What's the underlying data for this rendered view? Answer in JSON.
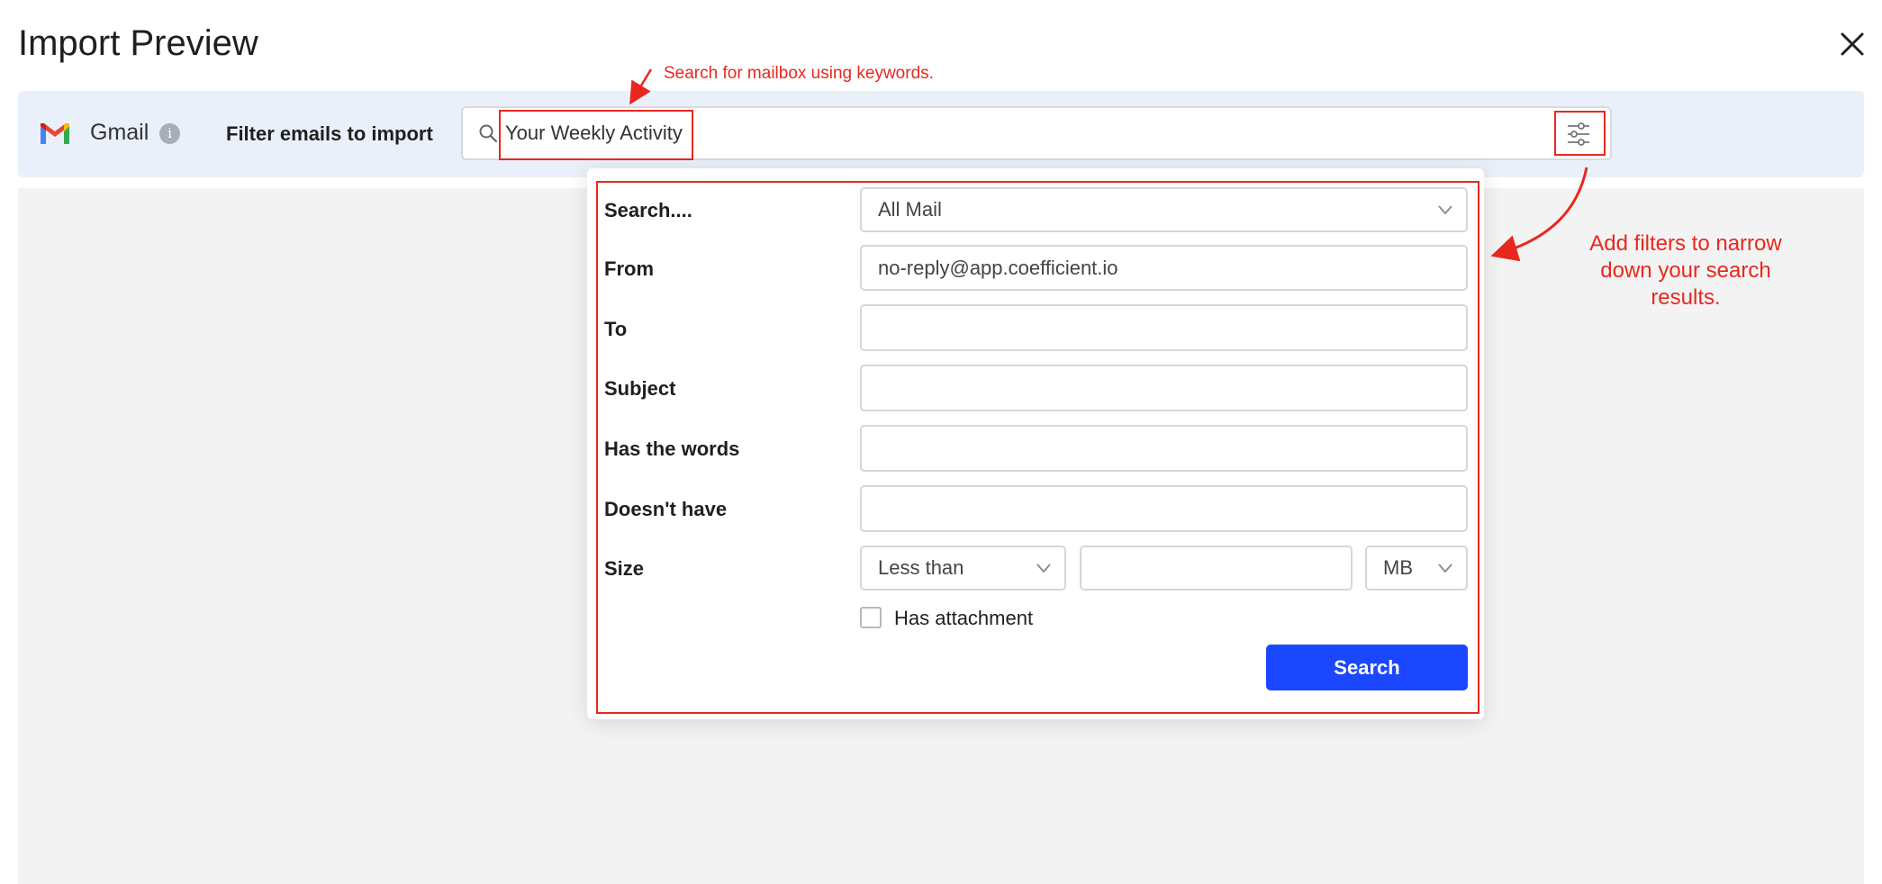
{
  "header": {
    "title": "Import Preview"
  },
  "toolbar": {
    "provider": "Gmail",
    "info_icon": "i",
    "filter_label": "Filter emails to import",
    "search_value": "Your Weekly Activity"
  },
  "annotations": {
    "search_hint": "Search for mailbox using keywords.",
    "filter_hint": [
      "Add filters to narrow",
      "down your search",
      "results."
    ],
    "color": "#e8281e"
  },
  "filters": {
    "search_in": {
      "label": "Search....",
      "value": "All Mail"
    },
    "from": {
      "label": "From",
      "value": "no-reply@app.coefficient.io"
    },
    "to": {
      "label": "To",
      "value": ""
    },
    "subject": {
      "label": "Subject",
      "value": ""
    },
    "has_words": {
      "label": "Has the words",
      "value": ""
    },
    "doesnt_have": {
      "label": "Doesn't have",
      "value": ""
    },
    "size": {
      "label": "Size",
      "operator": "Less than",
      "value": "",
      "unit": "MB"
    },
    "has_attachment": {
      "label": "Has attachment",
      "checked": false
    },
    "search_button": "Search"
  },
  "colors": {
    "accent": "#1a47ff",
    "toolbar_bg": "#eaf0f9",
    "content_bg": "#f3f3f3"
  },
  "icons": [
    "close-icon",
    "gmail-logo-icon",
    "info-icon",
    "search-icon",
    "filter-sliders-icon",
    "chevron-down-icon"
  ]
}
